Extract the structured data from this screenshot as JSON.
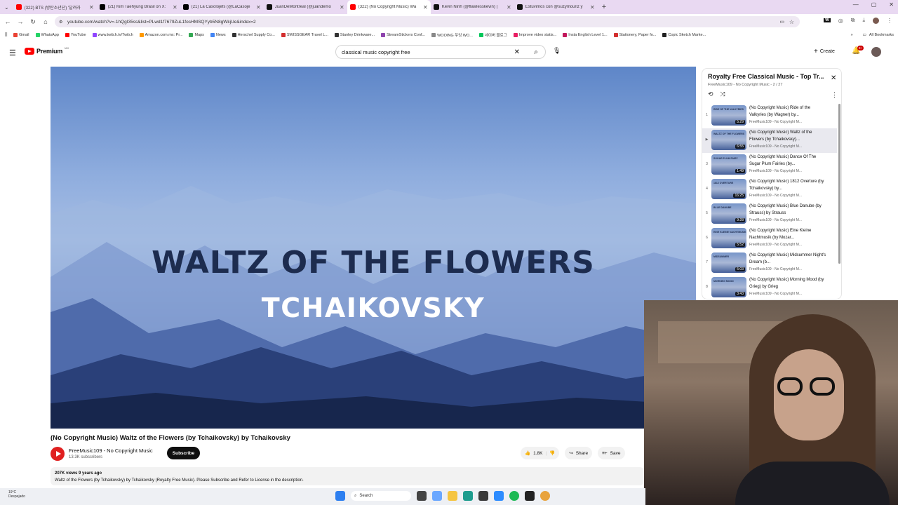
{
  "browser": {
    "tabs": [
      {
        "title": "(322) BTS (방탄소년단) '달려라",
        "color": "#ff0000",
        "active": false
      },
      {
        "title": "(21) Kim Taehyung Brasil on X:",
        "color": "#000000",
        "active": false
      },
      {
        "title": "(21) La Casolojefs (@LaCasoje",
        "color": "#000000",
        "active": false
      },
      {
        "title": "JuanDeMontreal (@juandemo",
        "color": "#111111",
        "active": false
      },
      {
        "title": "(322) (No Copyright Music) Wa",
        "color": "#ff0000",
        "active": true
      },
      {
        "title": "Kevin Ninh (@flawlesskevin) |",
        "color": "#111111",
        "active": false
      },
      {
        "title": "Estuvimos con @suzymouriz y",
        "color": "#111111",
        "active": false
      }
    ],
    "url": "youtube.com/watch?v=-1hQgI35ss&list=PLwd1f7679ZuL1fosHMSQYyb5N8gWkjUe&index=2",
    "bookmarks": [
      {
        "label": "Gmail",
        "color": "#ea4335"
      },
      {
        "label": "WhatsApp",
        "color": "#25d366"
      },
      {
        "label": "YouTube",
        "color": "#ff0000"
      },
      {
        "label": "www.twitch.tv/Twitch",
        "color": "#9146ff"
      },
      {
        "label": "Amazon.com.mx: Pr...",
        "color": "#ff9900"
      },
      {
        "label": "Maps",
        "color": "#34a853"
      },
      {
        "label": "News",
        "color": "#4285f4"
      },
      {
        "label": "Herschel Supply Co...",
        "color": "#333333"
      },
      {
        "label": "SWISSGEAR Travel L...",
        "color": "#d32f2f"
      },
      {
        "label": "Stanley Drinkware...",
        "color": "#333333"
      },
      {
        "label": "StreamStickers Conf...",
        "color": "#8e44ad"
      },
      {
        "label": "WOOING 우잉 WO...",
        "color": "#888888"
      },
      {
        "label": "네이버 블로그",
        "color": "#03c75a"
      },
      {
        "label": "Improve video statis...",
        "color": "#e91e63"
      },
      {
        "label": "Insta English Level 1...",
        "color": "#c2185b"
      },
      {
        "label": "Stationery, Paper fo...",
        "color": "#d32f2f"
      },
      {
        "label": "Copic Sketch Marke...",
        "color": "#222222"
      }
    ],
    "all_bookmarks": "All Bookmarks"
  },
  "yt": {
    "logo_text": "Premium",
    "logo_country": "MX",
    "search_value": "classical music copyright free",
    "create_label": "Create",
    "notif_badge": "9+"
  },
  "video": {
    "overlay_line1": "WALTZ OF THE FLOWERS",
    "overlay_line2": "TCHAIKOVSKY",
    "title": "(No Copyright Music) Waltz of the Flowers (by Tchaikovsky) by Tchaikovsky",
    "channel": "FreeMusic109 - No Copyright Music",
    "subscribers": "13.3K subscribers",
    "subscribe_label": "Subscribe",
    "likes": "1.8K",
    "share_label": "Share",
    "save_label": "Save",
    "views_meta": "207K views  9 years ago",
    "description": "Waltz of the Flowers (by Tchaikovsky) by Tchaikovsky (Royalty Free Music). Please Subscribe and Refer to License in the description."
  },
  "playlist": {
    "title": "Royalty Free Classical Music - Top Tr...",
    "subtitle": "FreeMusic109 - No Copyright Music - 2 / 27",
    "items": [
      {
        "index": "1",
        "title": "(No Copyright Music) Ride of the Valkyries (by Wagner) by...",
        "channel": "FreeMusic109 - No Copyright M...",
        "duration": "5:29",
        "cap": "RIDE OF THE VALKYRIES"
      },
      {
        "index": "▶",
        "title": "(No Copyright Music) Waltz of the Flowers (by Tchaikovsky)...",
        "channel": "FreeMusic109 - No Copyright M...",
        "duration": "6:55",
        "cap": "WALTZ OF THE FLOWERS"
      },
      {
        "index": "3",
        "title": "(No Copyright Music) Dance Of The Sugar Plum Fairies (by...",
        "channel": "FreeMusic109 - No Copyright M...",
        "duration": "1:49",
        "cap": "SUGAR PLUM FAIRY"
      },
      {
        "index": "4",
        "title": "(No Copyright Music) 1812 Overture (by Tchaikovsky) by...",
        "channel": "FreeMusic109 - No Copyright M...",
        "duration": "16:25",
        "cap": "1812 OVERTURE"
      },
      {
        "index": "5",
        "title": "(No Copyright Music) Blue Danube (by Strauss) by Strauss",
        "channel": "FreeMusic109 - No Copyright M...",
        "duration": "9:28",
        "cap": "BLUE DANUBE"
      },
      {
        "index": "6",
        "title": "(No Copyright Music) Eine Kleine Nachtmusik (by Mozar...",
        "channel": "FreeMusic109 - No Copyright M...",
        "duration": "5:52",
        "cap": "EINE KLEINE NACHTMUSIK"
      },
      {
        "index": "7",
        "title": "(No Copyright Music) Midsummer Night's Dream (b...",
        "channel": "FreeMusic109 - No Copyright M...",
        "duration": "5:03",
        "cap": "MIDSUMMER"
      },
      {
        "index": "8",
        "title": "(No Copyright Music) Morning Mood (by Grieg) by Grieg",
        "channel": "FreeMusic109 - No Copyright M...",
        "duration": "3:43",
        "cap": "MORNING MOOD"
      }
    ]
  },
  "taskbar": {
    "temp": "19°C",
    "weather": "Despejado",
    "search_label": "Search"
  }
}
